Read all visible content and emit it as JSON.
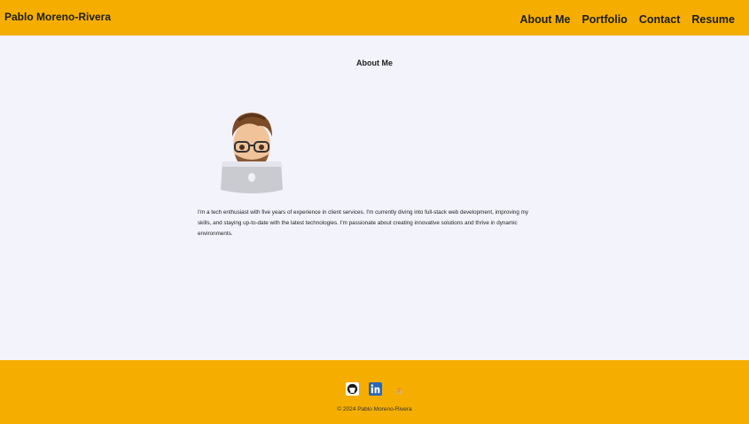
{
  "header": {
    "brand": "Pablo Moreno-Rivera",
    "nav": [
      "About Me",
      "Portfolio",
      "Contact",
      "Resume"
    ]
  },
  "about": {
    "title": "About Me",
    "bio": "I'm a tech enthusiast with five years of experience in client services. I'm currently diving into full-stack web development, improving my skills, and staying up-to-date with the latest technologies. I'm passionate about creating innovative solutions and thrive in dynamic environments."
  },
  "footer": {
    "social_icons": [
      "github-icon",
      "linkedin-icon",
      "stackoverflow-icon"
    ],
    "copyright": "© 2024 Pablo Moreno-Rivera"
  },
  "colors": {
    "accent": "#f5ae00",
    "background": "#f3f3fb",
    "text": "#1c1c1c"
  }
}
